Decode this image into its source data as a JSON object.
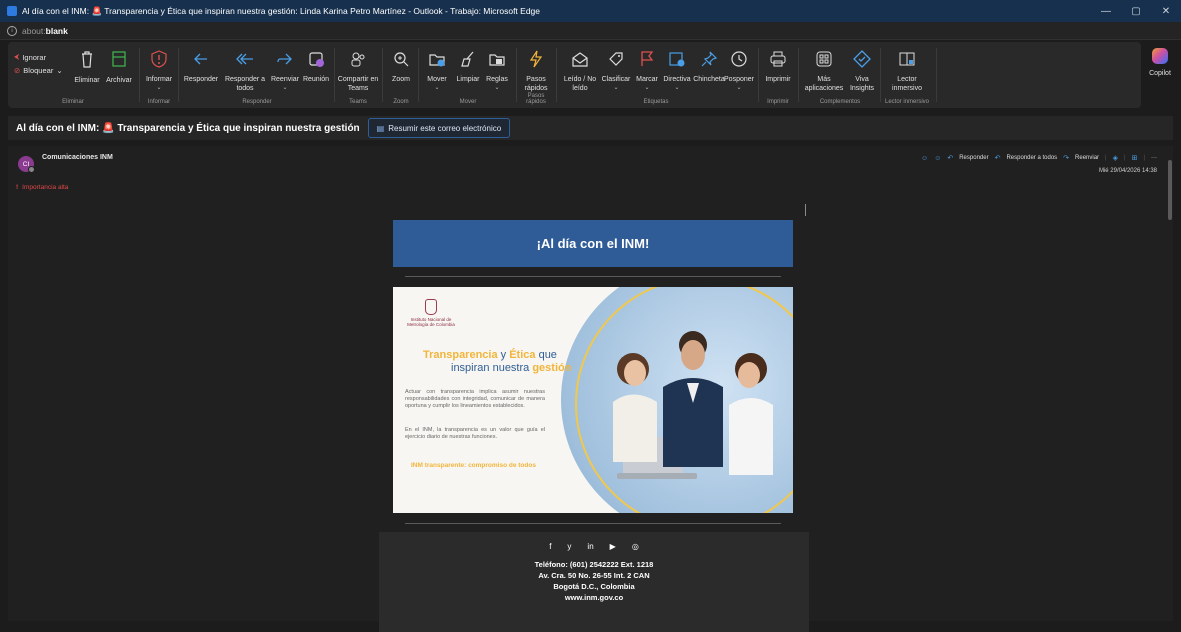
{
  "window": {
    "title": "Al día con el INM: 🚨 Transparencia y Ética que inspiran nuestra gestión: Linda Karina Petro Martínez - Outlook - Trabajo: Microsoft Edge",
    "minimize": "—",
    "restore": "▢",
    "close": "✕"
  },
  "address": {
    "prefix": "about:",
    "page": "blank"
  },
  "ribbon": {
    "eliminar": {
      "ignorar": "Ignorar",
      "bloquear": "Bloquear",
      "eliminar": "Eliminar",
      "archivar": "Archivar",
      "label": "Eliminar"
    },
    "informar": {
      "btn": "Informar",
      "label": "Informar"
    },
    "responder": {
      "responder": "Responder",
      "responder_todos_1": "Responder a",
      "responder_todos_2": "todos",
      "reenviar": "Reenviar",
      "reunion": "Reunión",
      "label": "Responder"
    },
    "teams": {
      "btn1": "Compartir en",
      "btn2": "Teams",
      "label": "Teams"
    },
    "zoom": {
      "btn": "Zoom",
      "label": "Zoom"
    },
    "mover": {
      "mover": "Mover",
      "limpiar": "Limpiar",
      "reglas": "Reglas",
      "label": "Mover"
    },
    "pasos": {
      "btn1": "Pasos",
      "btn2": "rápidos",
      "label": "Pasos rápidos"
    },
    "etiquetas": {
      "leido1": "Leído / No",
      "leido2": "leído",
      "clasificar": "Clasificar",
      "marcar": "Marcar",
      "directiva": "Directiva",
      "chincheta": "Chincheta",
      "posponer": "Posponer",
      "label": "Etiquetas"
    },
    "imprimir": {
      "btn": "Imprimir",
      "label": "Imprimir"
    },
    "complementos": {
      "mas1": "Más",
      "mas2": "aplicaciones",
      "viva1": "Viva",
      "viva2": "Insights",
      "label": "Complementos"
    },
    "lector": {
      "btn1": "Lector",
      "btn2": "inmersivo",
      "label": "Lector inmersivo"
    },
    "copilot": "Copilot"
  },
  "message": {
    "subject_prefix": "Al día con el INM:",
    "subject_rest": "Transparencia y Ética que inspiran nuestra gestión",
    "summarize": "Resumir este correo electrónico",
    "avatar": "CI",
    "sender": "Comunicaciones INM",
    "importance": "Importancia alta",
    "actions": {
      "responder": "Responder",
      "responder_todos": "Responder a todos",
      "reenviar": "Reenviar"
    },
    "date": "Mié 29/04/2026 14:38"
  },
  "email": {
    "banner": "¡Al día con el INM!",
    "org": "Instituto Nacional de Metrología de Colombia",
    "head1_a": "Transparencia",
    "head1_b": " y ",
    "head1_c": "Ética",
    "head1_d": " que",
    "head2_a": "inspiran nuestra ",
    "head2_b": "gestión",
    "p1": "Actuar con transparencia implica asumir nuestras responsabilidades con integridad, comunicar de manera oportuna y cumplir los lineamientos establecidos.",
    "p2": "En el INM, la transparencia es un valor que guía el ejercicio diario de nuestras funciones.",
    "slogan": "INM transparente: compromiso de todos",
    "footer": {
      "social": [
        "f",
        "y",
        "in",
        "▶",
        "◎"
      ],
      "telefono": "Teléfono: (601) 2542222 Ext. 1218",
      "direccion": "Av. Cra. 50 No. 26-55 Int. 2 CAN",
      "ciudad": "Bogotá D.C., Colombia",
      "web": "www.inm.gov.co"
    }
  },
  "colors": {
    "accent": "#2f5c97",
    "gold": "#f2b53a",
    "danger": "#e04848"
  }
}
